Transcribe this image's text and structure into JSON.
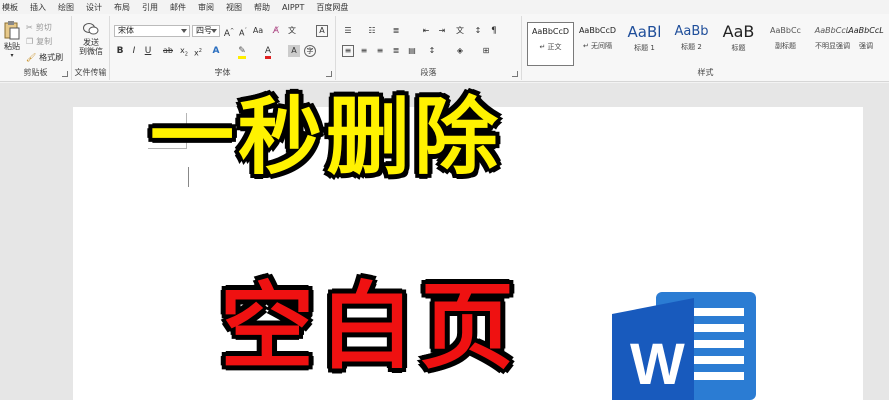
{
  "ribbon_tabs": [
    "模板",
    "插入",
    "绘图",
    "设计",
    "布局",
    "引用",
    "邮件",
    "审阅",
    "视图",
    "帮助",
    "AIPPT",
    "百度网盘"
  ],
  "clipboard": {
    "paste_label": "粘贴",
    "cut_label": "剪切",
    "copy_label": "复制",
    "format_painter_label": "格式刷",
    "group_label": "剪贴板"
  },
  "file_transfer": {
    "send_label_line1": "发送",
    "send_label_line2": "到微信",
    "group_label": "文件传输"
  },
  "font": {
    "font_name": "宋体",
    "font_size": "四号",
    "group_label": "字体"
  },
  "paragraph": {
    "group_label": "段落"
  },
  "styles": {
    "items": [
      {
        "sample": "AaBbCcD",
        "name": "↵ 正文"
      },
      {
        "sample": "AaBbCcD",
        "name": "↵ 无间隔"
      },
      {
        "sample": "AaBl",
        "name": "标题 1"
      },
      {
        "sample": "AaBb",
        "name": "标题 2"
      },
      {
        "sample": "AaB",
        "name": "标题"
      },
      {
        "sample": "AaBbCc",
        "name": "副标题"
      },
      {
        "sample": "AaBbCcL",
        "name": "不明显强调"
      },
      {
        "sample": "AaBbCcL",
        "name": "强调"
      }
    ],
    "group_label": "样式"
  },
  "document": {
    "headline_line1": "一秒删除",
    "headline_line2": "空白页",
    "logo_letter": "W"
  },
  "colors": {
    "headline1": "#fff200",
    "headline2": "#ef1111",
    "word_blue": "#2b5797"
  }
}
